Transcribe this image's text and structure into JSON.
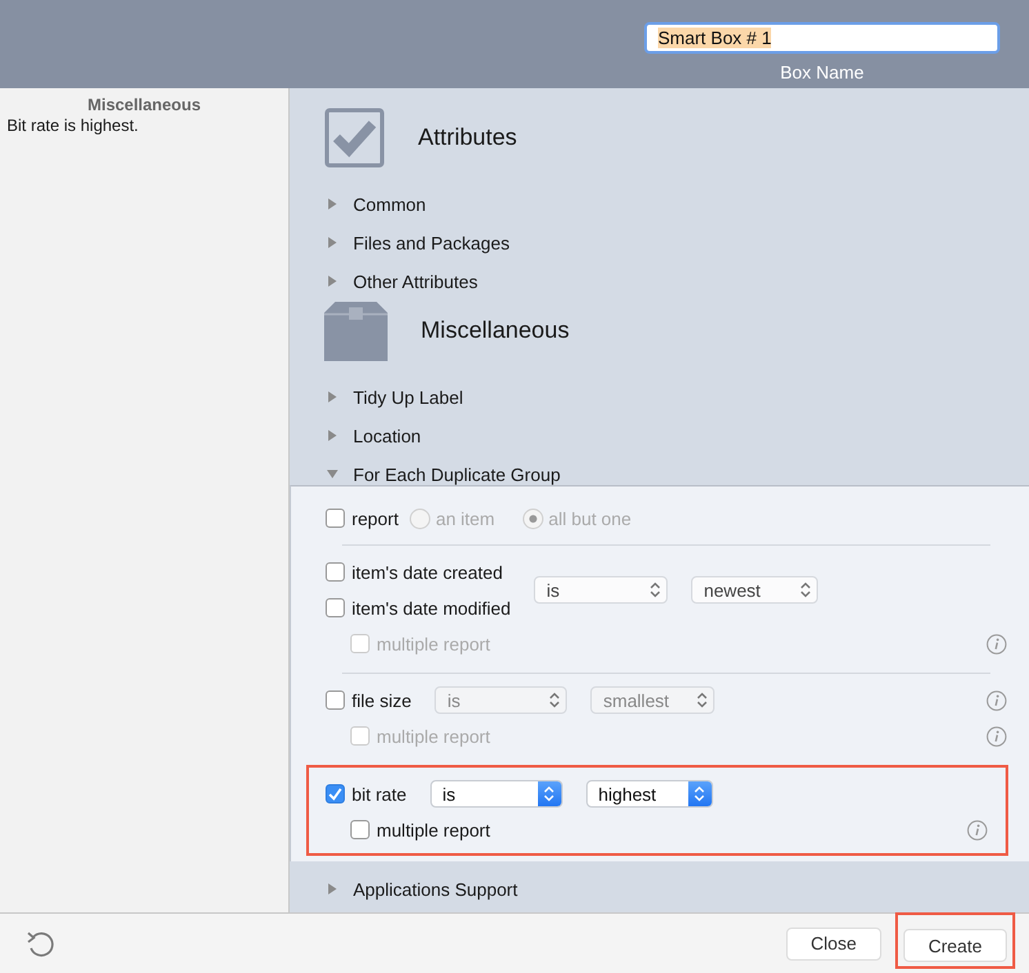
{
  "header": {
    "name_field": {
      "value": "Smart Box # 1",
      "selected_text": true
    },
    "name_label": "Box Name"
  },
  "sidebar": {
    "title": "Miscellaneous",
    "description": "Bit rate is highest."
  },
  "sections": [
    {
      "title": "Attributes",
      "items": [
        {
          "label": "Common",
          "expanded": false
        },
        {
          "label": "Files and Packages",
          "expanded": false
        },
        {
          "label": "Other Attributes",
          "expanded": false
        }
      ]
    },
    {
      "title": "Miscellaneous",
      "items": [
        {
          "label": "Tidy Up Label",
          "expanded": false
        },
        {
          "label": "Location",
          "expanded": false
        },
        {
          "label": "For Each Duplicate Group",
          "expanded": true
        }
      ]
    }
  ],
  "panel": {
    "groups": [
      {
        "kind": "report",
        "checkbox": {
          "label": "report",
          "checked": false,
          "disabled": false
        },
        "radios": [
          {
            "label": "an item",
            "selected": false,
            "disabled": true
          },
          {
            "label": "all but one",
            "selected": true,
            "disabled": true
          }
        ],
        "highlighted": false
      },
      {
        "kind": "criterion",
        "checkboxes": [
          {
            "label": "item's date created",
            "checked": false,
            "disabled": false
          },
          {
            "label": "item's date modified",
            "checked": false,
            "disabled": false
          }
        ],
        "popups": [
          {
            "value": "is",
            "active": false,
            "disabled": false
          },
          {
            "value": "newest",
            "active": false,
            "disabled": false
          }
        ],
        "info": false,
        "sub": {
          "label": "multiple report",
          "checked": false,
          "disabled": true,
          "info": true
        },
        "highlighted": false
      },
      {
        "kind": "criterion",
        "checkboxes": [
          {
            "label": "file size",
            "checked": false,
            "disabled": false
          }
        ],
        "popups": [
          {
            "value": "is",
            "active": false,
            "disabled": true
          },
          {
            "value": "smallest",
            "active": false,
            "disabled": true
          }
        ],
        "info": true,
        "sub": {
          "label": "multiple report",
          "checked": false,
          "disabled": true,
          "info": true
        },
        "highlighted": false
      },
      {
        "kind": "criterion",
        "checkboxes": [
          {
            "label": "bit rate",
            "checked": true,
            "disabled": false
          }
        ],
        "popups": [
          {
            "value": "is",
            "active": true,
            "disabled": false
          },
          {
            "value": "highest",
            "active": true,
            "disabled": false
          }
        ],
        "info": false,
        "sub": {
          "label": "multiple report",
          "checked": false,
          "disabled": false,
          "info": true
        },
        "highlighted": true
      }
    ]
  },
  "trailing_items": [
    {
      "label": "Applications Support",
      "expanded": false
    }
  ],
  "footer": {
    "buttons": [
      {
        "label": "Close",
        "highlighted": false
      },
      {
        "label": "Create",
        "highlighted": true
      }
    ]
  }
}
